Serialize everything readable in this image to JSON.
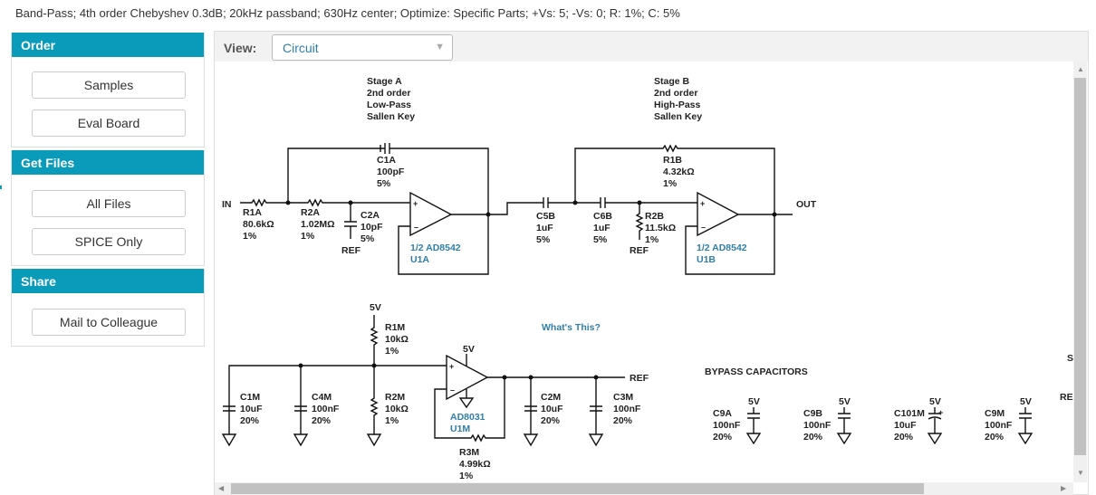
{
  "summary": "Band-Pass; 4th order Chebyshev 0.3dB; 20kHz passband; 630Hz center; Optimize: Specific Parts; +Vs: 5; -Vs: 0; R: 1%; C: 5%",
  "sidebar": {
    "order": {
      "title": "Order",
      "buttons": [
        "Samples",
        "Eval Board"
      ]
    },
    "get_files": {
      "title": "Get Files",
      "buttons": [
        "All Files",
        "SPICE Only"
      ]
    },
    "share": {
      "title": "Share",
      "buttons": [
        "Mail to Colleague"
      ]
    }
  },
  "view": {
    "label": "View:",
    "selected": "Circuit"
  },
  "colors": {
    "header": "#0a9bbb",
    "part_label": "#2f7fa8"
  },
  "schematic": {
    "stage_a": [
      "Stage A",
      "2nd order",
      "Low-Pass",
      "Sallen Key"
    ],
    "stage_b": [
      "Stage B",
      "2nd order",
      "High-Pass",
      "Sallen Key"
    ],
    "in": "IN",
    "out": "OUT",
    "ref": "REF",
    "v5": "5V",
    "R1A": [
      "R1A",
      "80.6kΩ",
      "1%"
    ],
    "R2A": [
      "R2A",
      "1.02MΩ",
      "1%"
    ],
    "C2A": [
      "C2A",
      "10pF",
      "5%"
    ],
    "C1A": [
      "C1A",
      "100pF",
      "5%"
    ],
    "U1A": [
      "1/2 AD8542",
      "U1A"
    ],
    "C5B": [
      "C5B",
      "1uF",
      "5%"
    ],
    "C6B": [
      "C6B",
      "1uF",
      "5%"
    ],
    "R2B": [
      "R2B",
      "11.5kΩ",
      "1%"
    ],
    "R1B": [
      "R1B",
      "4.32kΩ",
      "1%"
    ],
    "U1B": [
      "1/2 AD8542",
      "U1B"
    ],
    "R1M": [
      "R1M",
      "10kΩ",
      "1%"
    ],
    "R2M": [
      "R2M",
      "10kΩ",
      "1%"
    ],
    "C1M": [
      "C1M",
      "10uF",
      "20%"
    ],
    "C4M": [
      "C4M",
      "100nF",
      "20%"
    ],
    "U1M": [
      "AD8031",
      "U1M"
    ],
    "R3M": [
      "R3M",
      "4.99kΩ",
      "1%"
    ],
    "C2M": [
      "C2M",
      "10uF",
      "20%"
    ],
    "C3M": [
      "C3M",
      "100nF",
      "20%"
    ],
    "whats_this": "What's This?",
    "bypass_title": "BYPASS CAPACITORS",
    "bypass": [
      [
        "C9A",
        "100nF",
        "20%"
      ],
      [
        "C9B",
        "100nF",
        "20%"
      ],
      [
        "C101M",
        "10uF",
        "20%"
      ],
      [
        "C9M",
        "100nF",
        "20%"
      ]
    ],
    "clipped": [
      "S",
      "RE"
    ]
  }
}
